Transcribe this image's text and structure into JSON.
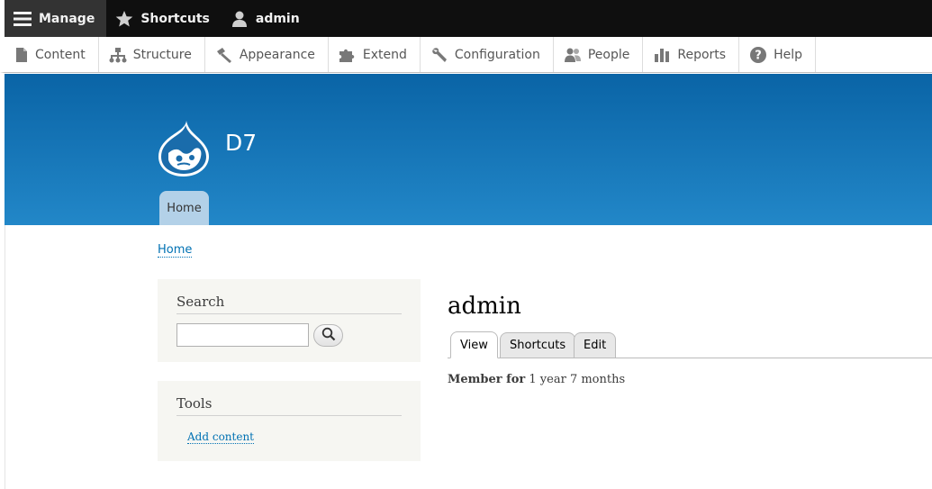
{
  "toolbar": {
    "manage_label": "Manage",
    "shortcuts_label": "Shortcuts",
    "user_label": "admin"
  },
  "tray": {
    "items": [
      {
        "label": "Content",
        "icon": "file-icon"
      },
      {
        "label": "Structure",
        "icon": "sitemap-icon"
      },
      {
        "label": "Appearance",
        "icon": "paintbrush-icon"
      },
      {
        "label": "Extend",
        "icon": "puzzle-icon"
      },
      {
        "label": "Configuration",
        "icon": "wrench-icon"
      },
      {
        "label": "People",
        "icon": "people-icon"
      },
      {
        "label": "Reports",
        "icon": "bar-chart-icon"
      },
      {
        "label": "Help",
        "icon": "help-icon"
      }
    ]
  },
  "header": {
    "site_name": "D7",
    "primary_tab": "Home",
    "color_top": "#0a64a6",
    "color_bottom": "#2287c8"
  },
  "breadcrumb": {
    "home": "Home"
  },
  "sidebar": {
    "search_title": "Search",
    "search_value": "",
    "tools_title": "Tools",
    "add_content": "Add content"
  },
  "main": {
    "title": "admin",
    "tabs": [
      {
        "label": "View",
        "active": true
      },
      {
        "label": "Shortcuts",
        "active": false
      },
      {
        "label": "Edit",
        "active": false
      }
    ],
    "member_for_label": "Member for",
    "member_for_value": "1 year 7 months"
  }
}
